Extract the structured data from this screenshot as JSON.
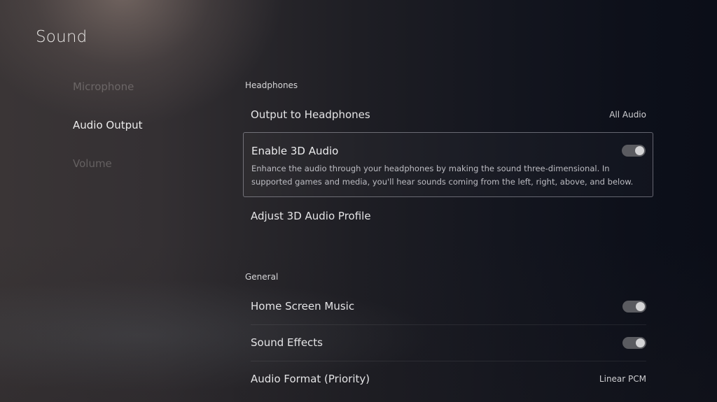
{
  "page": {
    "title": "Sound"
  },
  "sidebar": {
    "items": [
      {
        "label": "Microphone",
        "active": false
      },
      {
        "label": "Audio Output",
        "active": true
      },
      {
        "label": "Volume",
        "active": false
      }
    ]
  },
  "sections": {
    "headphones": {
      "label": "Headphones",
      "output_to_headphones": {
        "label": "Output to Headphones",
        "value": "All Audio"
      },
      "enable_3d_audio": {
        "label": "Enable 3D Audio",
        "description": "Enhance the audio through your headphones by making the sound three-dimensional. In supported games and media, you'll hear sounds coming from the left, right, above, and below.",
        "enabled": true
      },
      "adjust_3d_profile": {
        "label": "Adjust 3D Audio Profile"
      }
    },
    "general": {
      "label": "General",
      "home_screen_music": {
        "label": "Home Screen Music",
        "enabled": true
      },
      "sound_effects": {
        "label": "Sound Effects",
        "enabled": true
      },
      "audio_format": {
        "label": "Audio Format (Priority)",
        "value": "Linear PCM"
      }
    }
  }
}
